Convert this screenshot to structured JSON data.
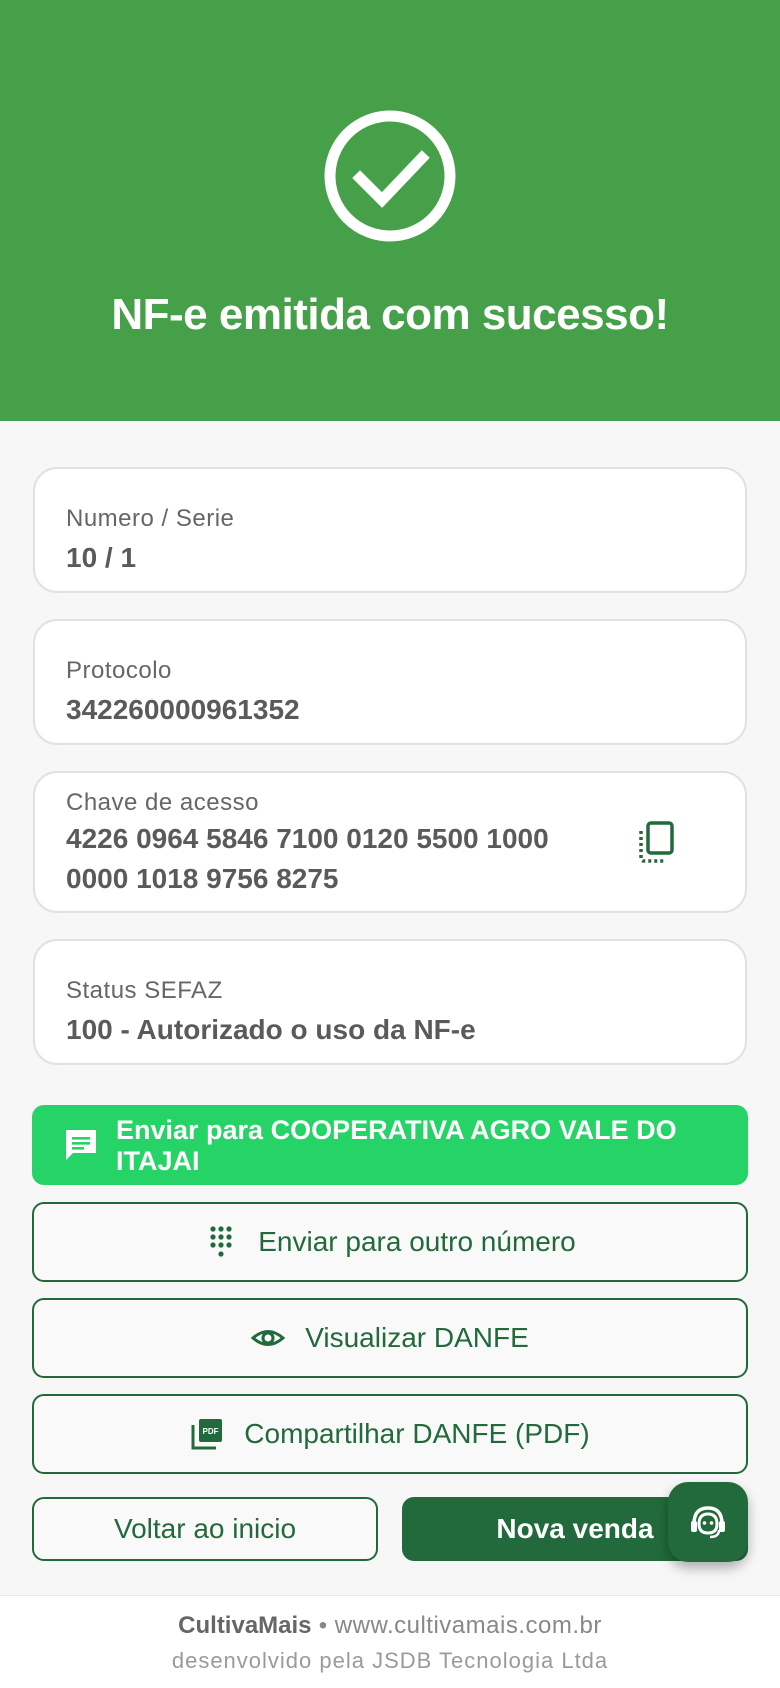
{
  "header": {
    "icon": "check-circle-icon",
    "title": "NF-e emitida com sucesso!",
    "color": "#46a049"
  },
  "details": {
    "numero": {
      "label": "Numero / Serie",
      "value": "10 / 1"
    },
    "protocolo": {
      "label": "Protocolo",
      "value": "342260000961352"
    },
    "chave": {
      "label": "Chave de acesso",
      "line1": "4226 0964 5846 7100 0120 5500 1000",
      "line2": "0000 1018 9756 8275",
      "icon": "copy-icon"
    },
    "status": {
      "label": "Status SEFAZ",
      "value": "100 - Autorizado o uso da NF-e"
    }
  },
  "actions": {
    "whatsapp": {
      "label": "Enviar para COOPERATIVA AGRO VALE DO ITAJAI",
      "icon": "message-icon",
      "color": "#25d366"
    },
    "other_number": {
      "label": "Enviar para outro número",
      "icon": "dialpad-icon"
    },
    "view_danfe": {
      "label": "Visualizar DANFE",
      "icon": "eye-icon"
    },
    "share_danfe": {
      "label": "Compartilhar DANFE (PDF)",
      "icon": "pdf-icon"
    },
    "back": {
      "label": "Voltar ao inicio"
    },
    "new_sale": {
      "label": "Nova venda",
      "color": "#226a3b"
    },
    "support_fab": {
      "icon": "support-agent-icon"
    }
  },
  "footer": {
    "brand": "CultivaMais",
    "separator": " • ",
    "site": "www.cultivamais.com.br",
    "credit": "desenvolvido pela JSDB Tecnologia Ltda"
  }
}
